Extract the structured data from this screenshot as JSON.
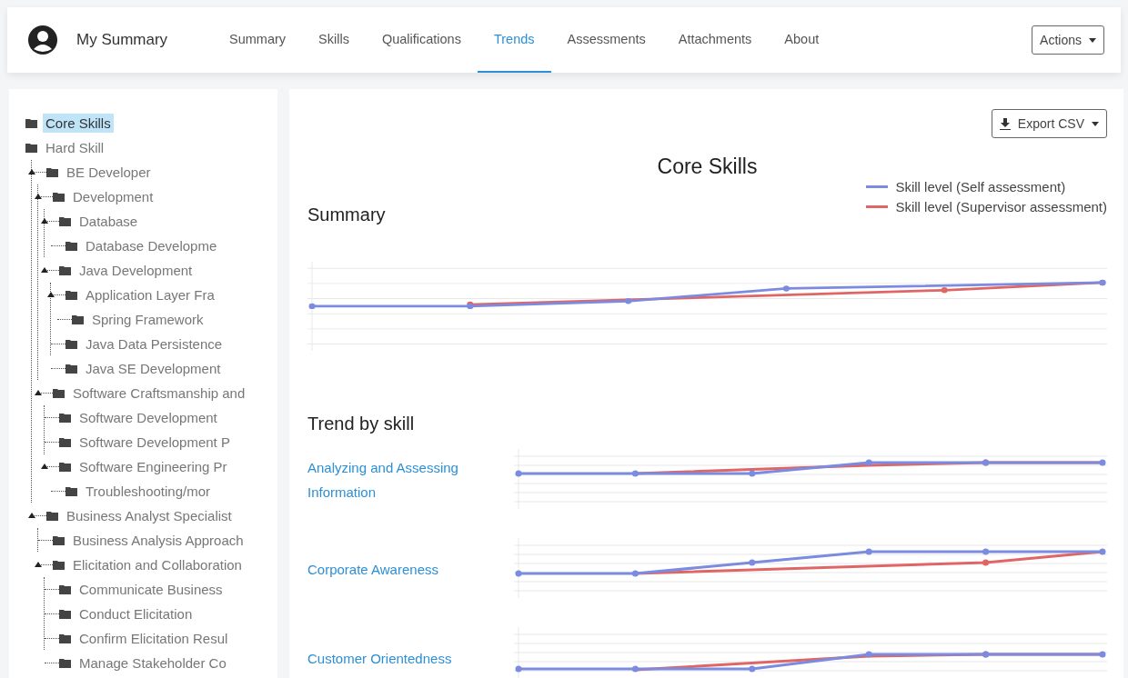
{
  "header": {
    "title": "My Summary"
  },
  "tabs": [
    {
      "label": "Summary",
      "selected": false
    },
    {
      "label": "Skills",
      "selected": false
    },
    {
      "label": "Qualifications",
      "selected": false
    },
    {
      "label": "Trends",
      "selected": true
    },
    {
      "label": "Assessments",
      "selected": false
    },
    {
      "label": "Attachments",
      "selected": false
    },
    {
      "label": "About",
      "selected": false
    }
  ],
  "actions_button": "Actions",
  "tree": [
    {
      "label": "Core Skills",
      "selected": true
    },
    {
      "label": "Hard Skill",
      "selected": false,
      "children": [
        {
          "label": "BE Developer",
          "selected": false,
          "children": [
            {
              "label": "Development",
              "selected": false,
              "children": [
                {
                  "label": "Database",
                  "selected": false,
                  "children": [
                    {
                      "label": "Database Developme",
                      "selected": false
                    }
                  ]
                },
                {
                  "label": "Java Development",
                  "selected": false,
                  "children": [
                    {
                      "label": "Application Layer Fra",
                      "selected": false,
                      "children": [
                        {
                          "label": "Spring Framework",
                          "selected": false
                        }
                      ]
                    },
                    {
                      "label": "Java Data Persistence",
                      "selected": false
                    },
                    {
                      "label": "Java SE Development",
                      "selected": false
                    }
                  ]
                }
              ]
            },
            {
              "label": "Software Craftsmanship and",
              "selected": false,
              "children": [
                {
                  "label": "Software Development",
                  "selected": false
                },
                {
                  "label": "Software Development P",
                  "selected": false
                },
                {
                  "label": "Software Engineering Pr",
                  "selected": false,
                  "children": [
                    {
                      "label": "Troubleshooting/mor",
                      "selected": false
                    }
                  ]
                }
              ]
            }
          ]
        },
        {
          "label": "Business Analyst Specialist",
          "selected": false,
          "children": [
            {
              "label": "Business Analysis Approach",
              "selected": false
            },
            {
              "label": "Elicitation and Collaboration",
              "selected": false,
              "children": [
                {
                  "label": "Communicate Business",
                  "selected": false
                },
                {
                  "label": "Conduct Elicitation",
                  "selected": false
                },
                {
                  "label": "Confirm Elicitation Resul",
                  "selected": false
                },
                {
                  "label": "Manage Stakeholder Co",
                  "selected": false
                }
              ]
            }
          ]
        }
      ]
    }
  ],
  "export_button": "Export CSV",
  "chart_title": "Core Skills",
  "legend": [
    {
      "label": "Skill level (Self assessment)",
      "color": "#7b8be0"
    },
    {
      "label": "Skill level (Supervisor assessment)",
      "color": "#e06666"
    }
  ],
  "summary_heading": "Summary",
  "trend_heading": "Trend by skill",
  "trend_rows": [
    {
      "label": "Analyzing and Assessing Information"
    },
    {
      "label": "Corporate Awareness"
    },
    {
      "label": "Customer Orientedness"
    }
  ]
}
